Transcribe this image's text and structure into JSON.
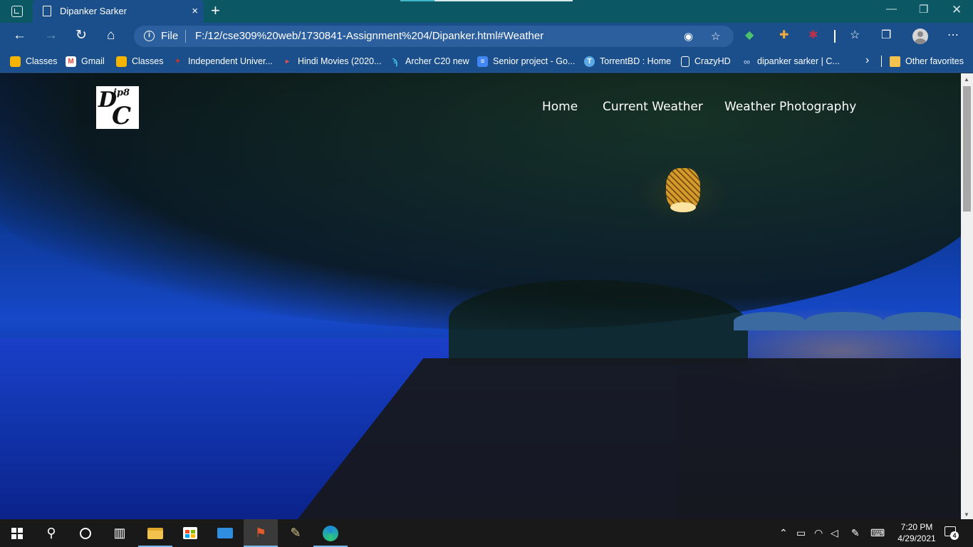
{
  "browser": {
    "tab": {
      "title": "Dipanker Sarker",
      "close_icon": "×",
      "new_tab_icon": "+"
    },
    "window_controls": {
      "minimize": "—",
      "restore": "❐",
      "close": "✕"
    },
    "address_bar": {
      "scheme_label": "File",
      "url": "F:/12/cse309%20web/1730841-Assignment%204/Dipanker.html#Weather"
    },
    "nav_icons": {
      "back": "←",
      "forward": "→",
      "refresh": "↻",
      "home": "⌂"
    },
    "toolbar_icons": [
      "location-icon",
      "add-favorite-icon",
      "extension-icon",
      "collections-icon",
      "favorites-icon",
      "profile-icon",
      "more-icon"
    ],
    "favorites": [
      {
        "label": "Classes",
        "icon": "classroom-icon",
        "color": "#f5b400"
      },
      {
        "label": "Gmail",
        "icon": "gmail-icon",
        "color": "#ea4335"
      },
      {
        "label": "Classes",
        "icon": "classroom-icon",
        "color": "#f5b400"
      },
      {
        "label": "Independent Univer...",
        "icon": "university-icon",
        "color": "#c0392b"
      },
      {
        "label": "Hindi Movies (2020...",
        "icon": "movie-icon",
        "color": "#c0392b"
      },
      {
        "label": "Archer C20 new",
        "icon": "tplink-icon",
        "color": "#3fb6d8"
      },
      {
        "label": "Senior project - Go...",
        "icon": "google-docs-icon",
        "color": "#4285f4"
      },
      {
        "label": "TorrentBD : Home",
        "icon": "torrentbd-icon",
        "color": "#5aa9e6"
      },
      {
        "label": "CrazyHD",
        "icon": "page-icon",
        "color": "#ffffff"
      },
      {
        "label": "dipanker sarker | C...",
        "icon": "link-icon",
        "color": "#9fb8d8"
      }
    ],
    "other_favorites": "Other favorites",
    "more_chevron": "›"
  },
  "page": {
    "logo": {
      "line1": "D",
      "line2": "C",
      "line3": "ip8"
    },
    "menu": [
      {
        "label": "Home"
      },
      {
        "label": "Current Weather"
      },
      {
        "label": "Weather Photography"
      }
    ]
  },
  "taskbar": {
    "apps": [
      "start-icon",
      "search-icon",
      "cortana-icon",
      "task-view-icon",
      "file-explorer-icon",
      "store-icon",
      "mail-icon",
      "app-icon",
      "app-icon",
      "edge-icon"
    ],
    "clock": {
      "time": "7:20 PM",
      "date": "4/29/2021"
    },
    "notifications_count": "4"
  }
}
